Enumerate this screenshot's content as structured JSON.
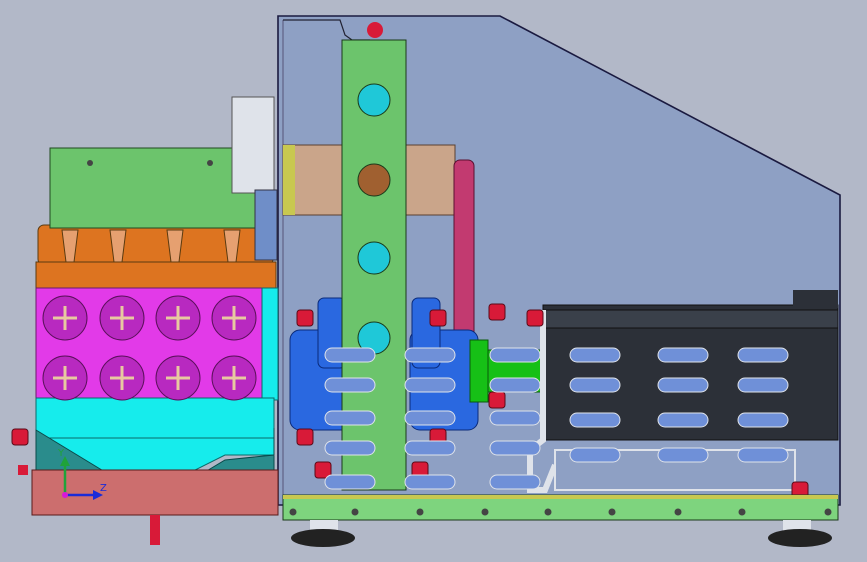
{
  "viewport": {
    "background": "#b2b8c8",
    "view_orientation": "side"
  },
  "triad": {
    "y_label": "Y",
    "z_label": "Z",
    "x_axis_color": "#1a2bd8",
    "y_axis_color": "#1fa33a",
    "z_axis_color": "#d81ad8"
  },
  "colors": {
    "housing_glass": "#8ea0c4",
    "column_green": "#6cc46c",
    "magenta_block": "#e23ae8",
    "orange_block": "#dd7420",
    "cyan_block": "#16ecec",
    "teal_hopper": "#2a8c8c",
    "red_base": "#cc6e6e",
    "blue_gear": "#2a68e0",
    "tan_sleeve": "#caa58a",
    "dark_motor": "#2c3038",
    "crimson_belt": "#c23a70",
    "bright_green_coupling": "#16c016",
    "red_fasteners": "#d81a38",
    "base_rail": "#7ed47e",
    "foot_black": "#222222"
  }
}
